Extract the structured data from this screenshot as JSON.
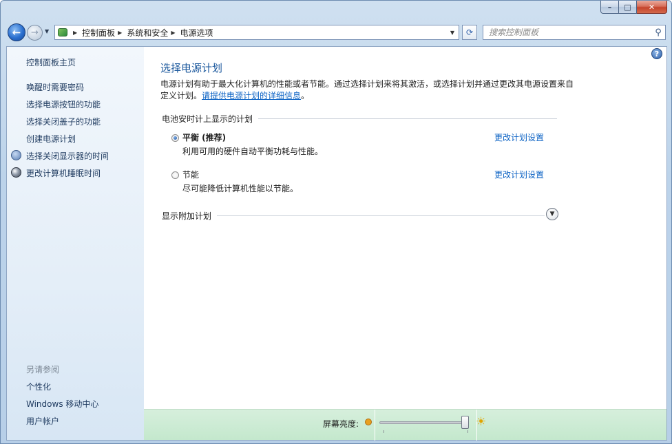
{
  "breadcrumb": [
    "控制面板",
    "系统和安全",
    "电源选项"
  ],
  "search": {
    "placeholder": "搜索控制面板"
  },
  "sidebar": {
    "home": "控制面板主页",
    "links": [
      "唤醒时需要密码",
      "选择电源按钮的功能",
      "选择关闭盖子的功能",
      "创建电源计划",
      "选择关闭显示器的时间",
      "更改计算机睡眠时间"
    ],
    "see_also_header": "另请参阅",
    "see_also": [
      "个性化",
      "Windows 移动中心",
      "用户帐户"
    ]
  },
  "main": {
    "title": "选择电源计划",
    "description": "电源计划有助于最大化计算机的性能或者节能。通过选择计划来将其激活，或选择计划并通过更改其电源设置来自定义计划。",
    "description_link": "请提供电源计划的详细信息",
    "description_end": "。",
    "battery_group": "电池安时计上显示的计划",
    "plans": [
      {
        "name": "平衡 (推荐)",
        "description": "利用可用的硬件自动平衡功耗与性能。",
        "link": "更改计划设置",
        "selected": true
      },
      {
        "name": "节能",
        "description": "尽可能降低计算机性能以节能。",
        "link": "更改计划设置",
        "selected": false
      }
    ],
    "extra_plans": "显示附加计划"
  },
  "status": {
    "brightness_label": "屏幕亮度:",
    "brightness_level": 0.96
  },
  "icons": {
    "back": "back-arrow-icon",
    "forward": "forward-arrow-icon",
    "search": "search-icon",
    "help": "help-icon"
  }
}
